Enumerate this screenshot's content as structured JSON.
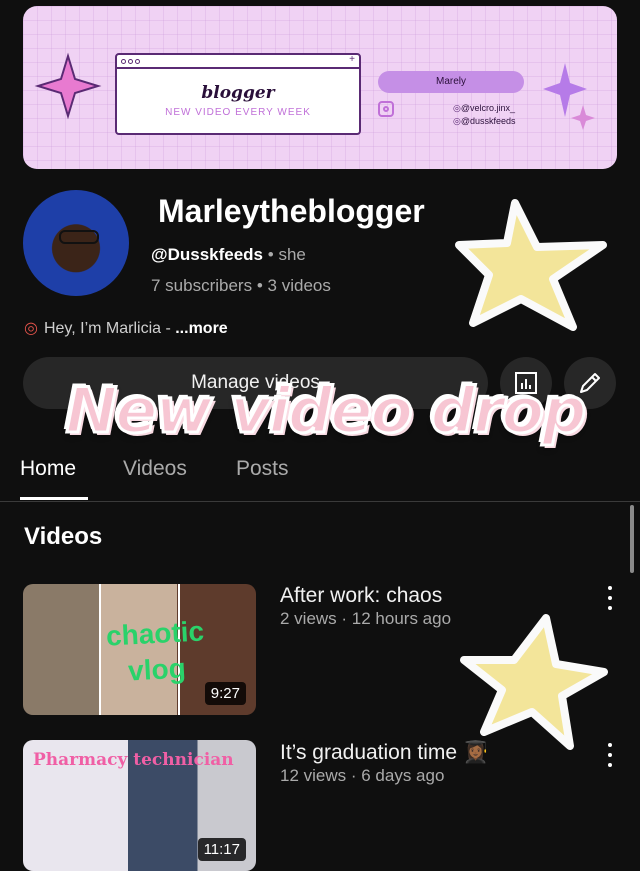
{
  "banner": {
    "title": "blogger",
    "subtitle": "NEW VIDEO EVERY WEEK",
    "pill_label": "Marely",
    "handles": [
      "@velcro.jinx_",
      "@dusskfeeds"
    ]
  },
  "channel": {
    "name": "Marleytheblogger",
    "handle": "@Dusskfeeds",
    "pronoun": "she",
    "separator": "•",
    "subscribers": "7 subscribers",
    "videos_count": "3 videos",
    "description": "Hey, I’m Marlicia - ",
    "more_label": "...more"
  },
  "actions": {
    "manage_label": "Manage videos"
  },
  "overlay": {
    "sticker_text": "New video drop"
  },
  "tabs": [
    {
      "label": "Home",
      "active": true
    },
    {
      "label": "Videos",
      "active": false
    },
    {
      "label": "Posts",
      "active": false
    }
  ],
  "section": {
    "title": "Videos"
  },
  "videos": [
    {
      "title": "After work: chaos",
      "meta": "2 views · 12 hours ago",
      "duration": "9:27",
      "thumbnail_caption": "chaotic vlog"
    },
    {
      "title": "It’s graduation time 👩🏾‍🎓",
      "meta": "12 views · 6 days ago",
      "duration": "11:17",
      "thumbnail_caption": "Pharmacy technician"
    }
  ],
  "colors": {
    "background": "#0f0f0f",
    "banner": "#f0d2f4",
    "sticker_text": "#f7c6d3",
    "star": "#f3e59a"
  }
}
